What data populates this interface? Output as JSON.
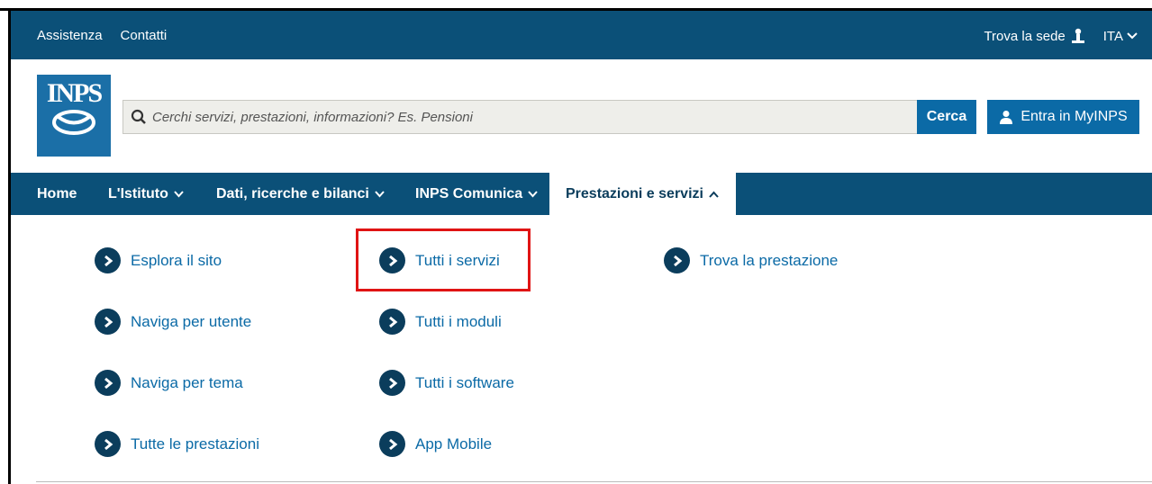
{
  "topbar": {
    "links": [
      "Assistenza",
      "Contatti"
    ],
    "trova_sede": "Trova la sede",
    "language": "ITA"
  },
  "header": {
    "logo_text": "INPS",
    "search_placeholder": "Cerchi servizi, prestazioni, informazioni? Es. Pensioni",
    "search_button": "Cerca",
    "login_button": "Entra in MyINPS"
  },
  "nav": {
    "items": [
      {
        "label": "Home"
      },
      {
        "label": "L'Istituto"
      },
      {
        "label": "Dati, ricerche e bilanci"
      },
      {
        "label": "INPS Comunica"
      },
      {
        "label": "Prestazioni e servizi"
      }
    ],
    "active": "Prestazioni e servizi"
  },
  "menu": {
    "col1": [
      "Esplora il sito",
      "Naviga per utente",
      "Naviga per tema",
      "Tutte le prestazioni"
    ],
    "col2": [
      "Tutti i servizi",
      "Tutti i moduli",
      "Tutti i software",
      "App Mobile"
    ],
    "col3": [
      "Trova la prestazione"
    ]
  },
  "colors": {
    "brand_dark": "#0b5078",
    "brand_blue": "#0b6aa6",
    "highlight": "#e01414"
  }
}
